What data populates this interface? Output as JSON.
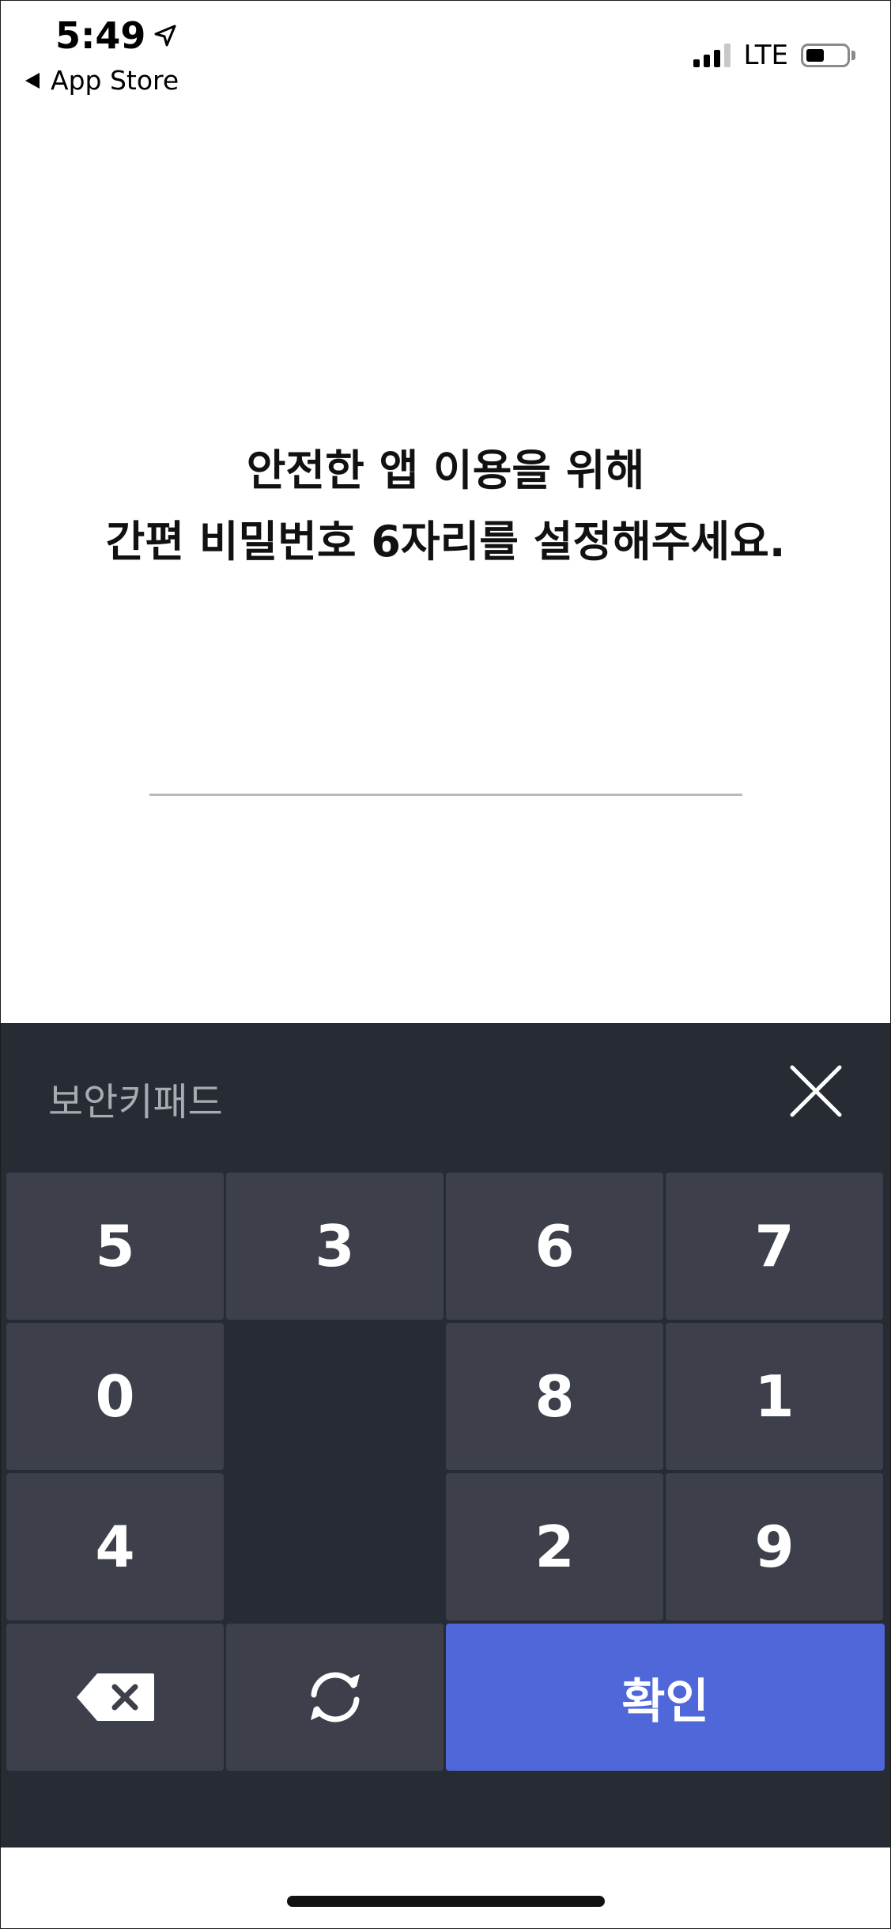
{
  "status_bar": {
    "time": "5:49",
    "back_label": "App Store",
    "network": "LTE"
  },
  "prompt": {
    "line1": "안전한 앱 이용을 위해",
    "line2": "간편 비밀번호 6자리를 설정해주세요."
  },
  "keypad": {
    "title": "보안키패드",
    "keys": {
      "r1c1": "5",
      "r1c2": "3",
      "r1c3": "6",
      "r1c4": "7",
      "r2c1": "0",
      "r2c3": "8",
      "r2c4": "1",
      "r3c1": "4",
      "r3c3": "2",
      "r3c4": "9"
    },
    "confirm_label": "확인"
  },
  "icons": {
    "location": "location-arrow-icon",
    "back": "back-triangle-icon",
    "close": "close-icon",
    "backspace": "backspace-icon",
    "shuffle": "refresh-icon"
  },
  "colors": {
    "keypad_bg": "#272b34",
    "key_bg": "#3d404a",
    "confirm_bg": "#5067da"
  }
}
